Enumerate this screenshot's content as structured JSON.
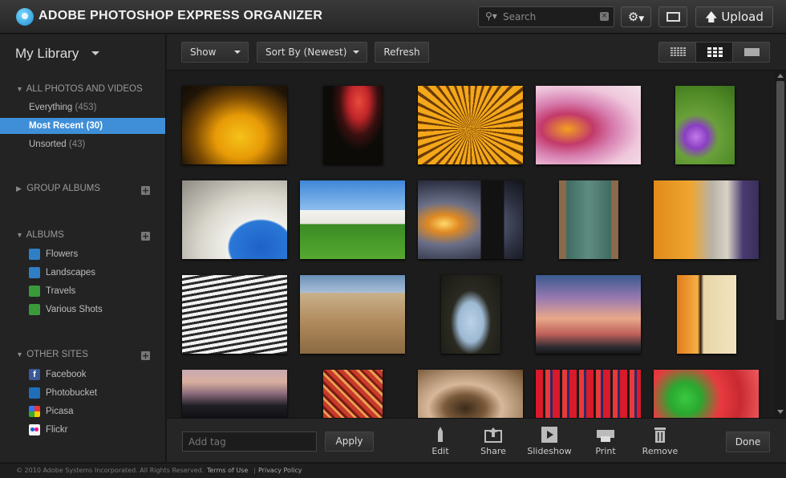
{
  "header": {
    "title": "ADOBE PHOTOSHOP EXPRESS ORGANIZER",
    "search_placeholder": "Search",
    "upload_label": "Upload",
    "upload_icon": "arrow-up-icon",
    "settings_icon": "gear-icon",
    "fullscreen_icon": "fullscreen-icon"
  },
  "sidebar": {
    "library_title": "My Library",
    "all_section": {
      "title": "ALL PHOTOS AND VIDEOS",
      "items": [
        {
          "label": "Everything",
          "count": "(453)"
        },
        {
          "label": "Most Recent",
          "count": "(30)"
        },
        {
          "label": "Unsorted",
          "count": "(43)"
        }
      ]
    },
    "group_albums": {
      "title": "GROUP ALBUMS"
    },
    "albums": {
      "title": "ALBUMS",
      "items": [
        {
          "label": "Flowers"
        },
        {
          "label": "Landscapes"
        },
        {
          "label": "Travels"
        },
        {
          "label": "Various Shots"
        }
      ]
    },
    "other_sites": {
      "title": "OTHER SITES",
      "items": [
        {
          "label": "Facebook"
        },
        {
          "label": "Photobucket"
        },
        {
          "label": "Picasa"
        },
        {
          "label": "Flickr"
        }
      ]
    }
  },
  "toolbar": {
    "show_label": "Show",
    "sort_label": "Sort By (Newest)",
    "refresh_label": "Refresh"
  },
  "actions": {
    "tag_placeholder": "Add tag",
    "apply_label": "Apply",
    "edit_label": "Edit",
    "share_label": "Share",
    "slideshow_label": "Slideshow",
    "print_label": "Print",
    "remove_label": "Remove",
    "done_label": "Done"
  },
  "footer": {
    "copyright": "© 2010 Adobe Systems Incorporated. All Rights Reserved.",
    "terms": "Terms of Use",
    "privacy": "Privacy Policy"
  },
  "colors": {
    "accent": "#3f8fd8",
    "background": "#1b1b1b",
    "sidebar": "#232323"
  }
}
